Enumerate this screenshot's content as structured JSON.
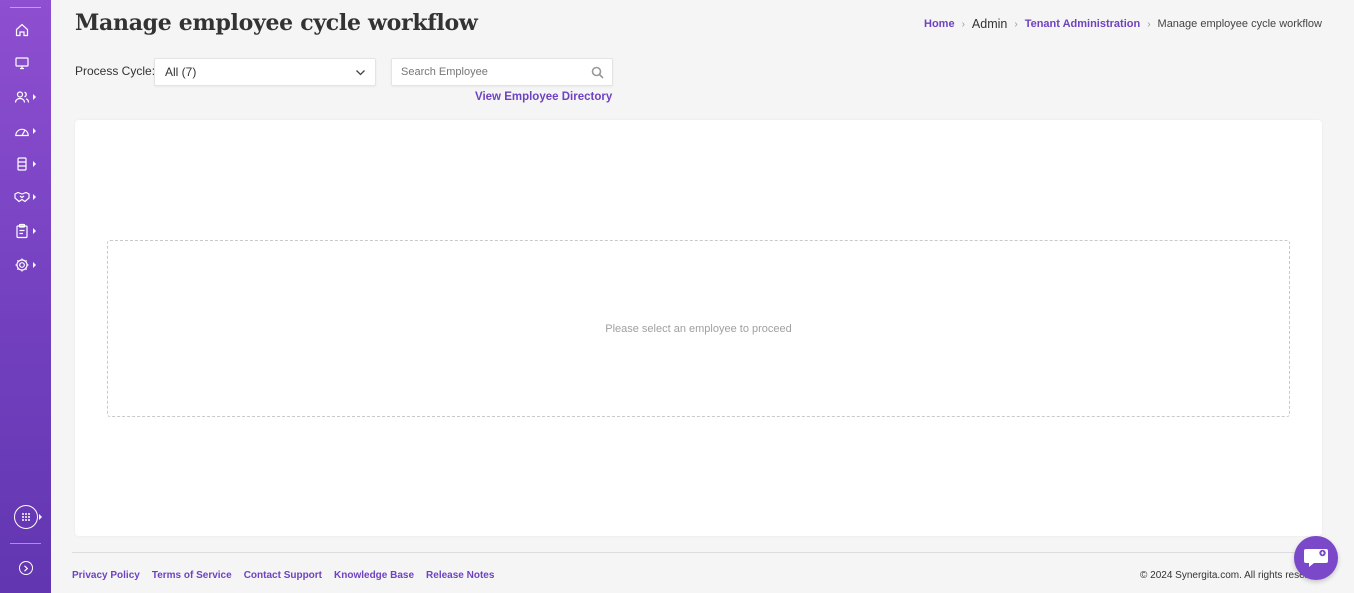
{
  "page": {
    "title": "Manage employee cycle workflow"
  },
  "breadcrumb": {
    "home": "Home",
    "admin": "Admin",
    "tenant": "Tenant Administration",
    "current": "Manage employee cycle workflow"
  },
  "filters": {
    "process_cycle_label": "Process Cycle:",
    "process_cycle_value": "All (7)",
    "search_placeholder": "Search Employee",
    "search_value": "",
    "directory_link": "View Employee Directory"
  },
  "main": {
    "empty_message": "Please select an employee to proceed"
  },
  "footer": {
    "links": [
      "Privacy Policy",
      "Terms of Service",
      "Contact Support",
      "Knowledge Base",
      "Release Notes"
    ],
    "copyright": "© 2024 Synergita.com. All rights reserved."
  },
  "sidebar": {
    "icons": [
      "home-icon",
      "monitor-icon",
      "users-icon",
      "dashboard-gauge-icon",
      "database-icon",
      "handshake-icon",
      "clipboard-icon",
      "settings-gear-icon"
    ],
    "apps_icon": "apps-grid-icon",
    "expand_icon": "expand-sidebar-icon"
  },
  "colors": {
    "accent": "#6f42c1",
    "sidebar_top": "#8e4fd0",
    "sidebar_bottom": "#6236b0",
    "chat_button": "#7a48c8"
  }
}
